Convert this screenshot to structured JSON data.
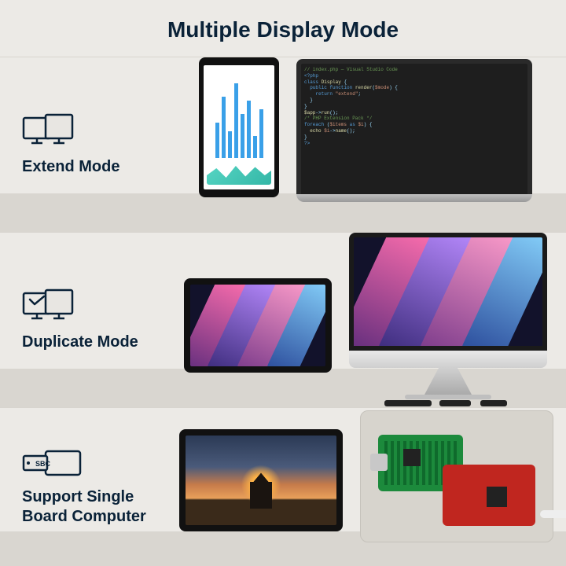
{
  "title": "Multiple Display Mode",
  "rows": [
    {
      "label": "Extend Mode",
      "icon": "extend-mode-icon"
    },
    {
      "label": "Duplicate Mode",
      "icon": "duplicate-mode-icon"
    },
    {
      "label": "Support Single\nBoard Computer",
      "icon": "sbc-icon",
      "icon_text": "SBC"
    }
  ],
  "colors": {
    "heading": "#0a2238",
    "icon_stroke": "#0a2238"
  }
}
